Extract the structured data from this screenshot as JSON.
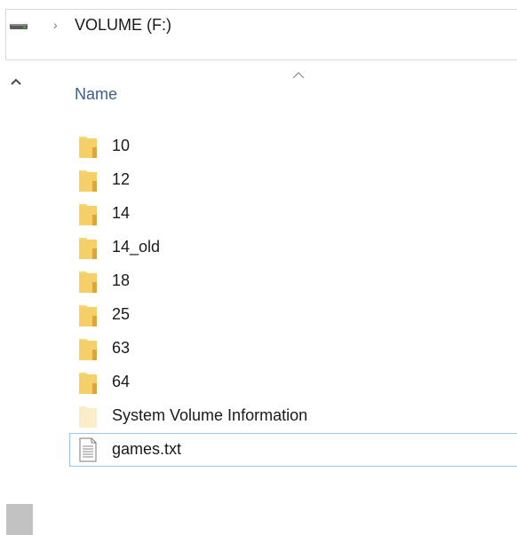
{
  "address_bar": {
    "icon": "drive-icon",
    "separator_icon": "chevron-right-icon",
    "crumb": "VOLUME (F:)"
  },
  "navigation_pane": {
    "collapse_icon": "chevron-up-icon"
  },
  "column_header": {
    "label": "Name",
    "sort_indicator": "sort-ascending-caret-icon"
  },
  "files": [
    {
      "name": "10",
      "type": "folder",
      "icon": "folder-icon"
    },
    {
      "name": "12",
      "type": "folder",
      "icon": "folder-icon"
    },
    {
      "name": "14",
      "type": "folder",
      "icon": "folder-icon"
    },
    {
      "name": "14_old",
      "type": "folder",
      "icon": "folder-icon"
    },
    {
      "name": "18",
      "type": "folder",
      "icon": "folder-icon"
    },
    {
      "name": "25",
      "type": "folder",
      "icon": "folder-icon"
    },
    {
      "name": "63",
      "type": "folder",
      "icon": "folder-icon"
    },
    {
      "name": "64",
      "type": "folder",
      "icon": "folder-icon"
    },
    {
      "name": "System Volume Information",
      "type": "hidden-folder",
      "icon": "folder-icon"
    },
    {
      "name": "games.txt",
      "type": "text-file",
      "icon": "text-file-icon",
      "focused": true
    }
  ],
  "colors": {
    "folder": "#f8d775",
    "folder_hidden": "#fbedc8",
    "header_text": "#3a5f8c",
    "focus_border": "#99c6ee"
  }
}
